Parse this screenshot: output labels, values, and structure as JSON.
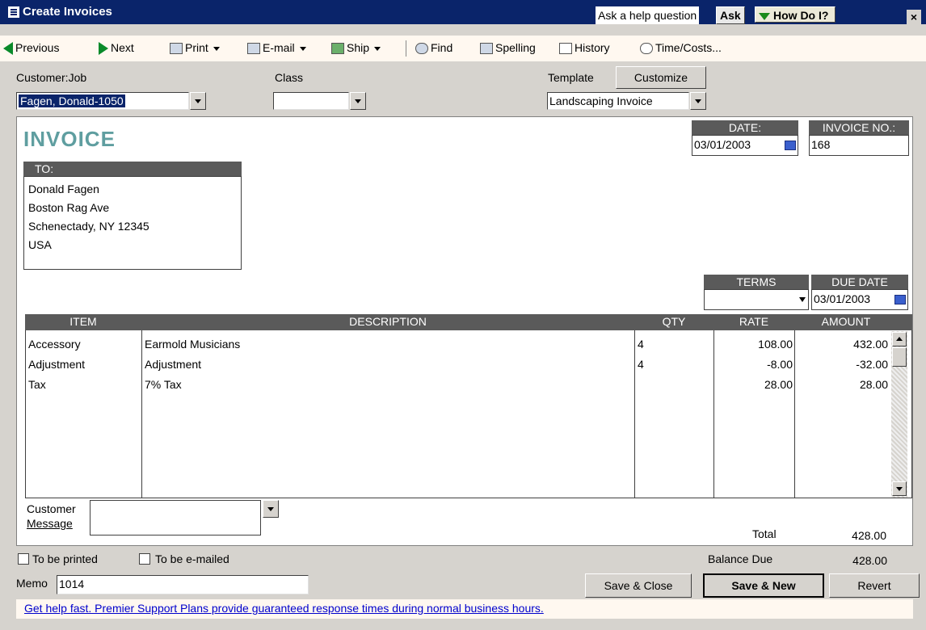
{
  "window": {
    "title": "Create Invoices",
    "help_placeholder": "Ask a help question",
    "ask_label": "Ask",
    "howdoi_label": "How Do I?",
    "close_glyph": "×"
  },
  "toolbar": {
    "previous": "Previous",
    "next": "Next",
    "print": "Print",
    "email": "E-mail",
    "ship": "Ship",
    "find": "Find",
    "spelling": "Spelling",
    "history": "History",
    "timecosts": "Time/Costs..."
  },
  "header": {
    "customer_job_label": "Customer:Job",
    "customer_job_value": "Fagen, Donald-1050",
    "class_label": "Class",
    "class_value": "",
    "template_label": "Template",
    "customize_label": "Customize",
    "template_value": "Landscaping Invoice"
  },
  "invoice": {
    "title": "INVOICE",
    "date_label": "DATE:",
    "date_value": "03/01/2003",
    "invoice_no_label": "INVOICE NO.:",
    "invoice_no_value": "168",
    "to_label": "TO:",
    "to_lines": [
      "Donald Fagen",
      "Boston Rag Ave",
      "Schenectady, NY 12345",
      "USA"
    ],
    "terms_label": "TERMS",
    "terms_value": "",
    "due_date_label": "DUE DATE",
    "due_date_value": "03/01/2003"
  },
  "items_table": {
    "columns": [
      "ITEM",
      "DESCRIPTION",
      "QTY",
      "RATE",
      "AMOUNT"
    ],
    "rows": [
      {
        "item": "Accessory",
        "description": "Earmold Musicians",
        "qty": "4",
        "rate": "108.00",
        "amount": "432.00"
      },
      {
        "item": "Adjustment",
        "description": "Adjustment",
        "qty": "4",
        "rate": "-8.00",
        "amount": "-32.00"
      },
      {
        "item": "Tax",
        "description": "7% Tax",
        "qty": "",
        "rate": "28.00",
        "amount": "28.00"
      }
    ]
  },
  "footer": {
    "customer_message_label_1": "Customer",
    "customer_message_label_2": "Message",
    "customer_message_value": "",
    "total_label": "Total",
    "total_value": "428.00",
    "to_be_printed": "To be printed",
    "to_be_emailed": "To be e-mailed",
    "balance_due_label": "Balance Due",
    "balance_due_value": "428.00",
    "memo_label": "Memo",
    "memo_value": "1014",
    "save_close": "Save & Close",
    "save_new": "Save & New",
    "revert": "Revert",
    "help_text": "Get help fast. Premier Support Plans provide guaranteed response times during normal business hours."
  }
}
